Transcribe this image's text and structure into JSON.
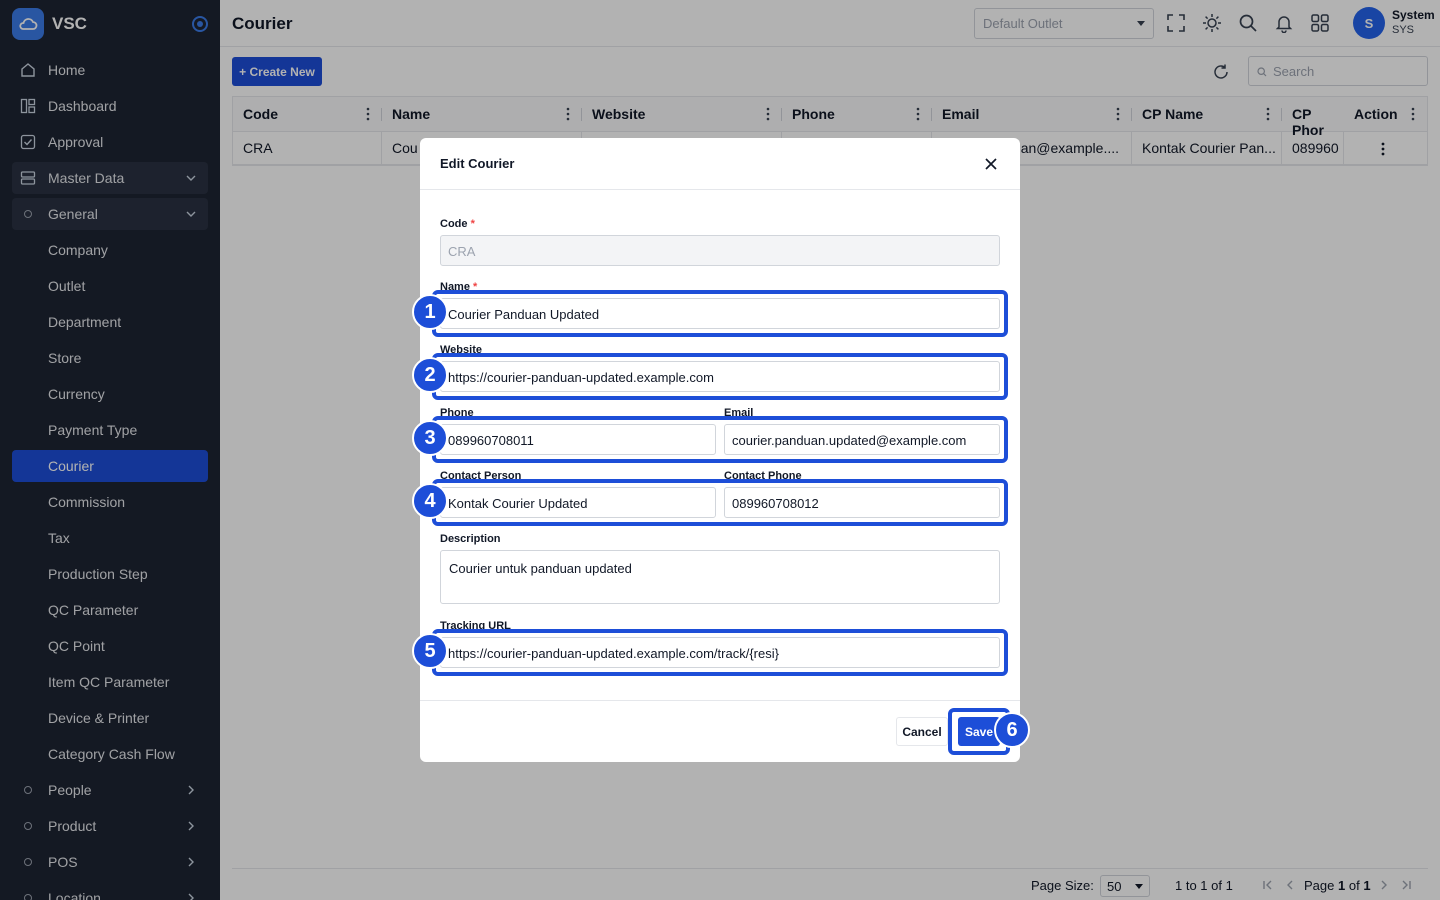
{
  "app": {
    "name": "VSC"
  },
  "sidebar": {
    "items": [
      {
        "label": "Home",
        "icon": "home-icon"
      },
      {
        "label": "Dashboard",
        "icon": "dashboard-icon"
      },
      {
        "label": "Approval",
        "icon": "approval-icon"
      },
      {
        "label": "Master Data",
        "icon": "database-icon"
      },
      {
        "label": "General",
        "icon": "circle-icon"
      }
    ],
    "sub_items": [
      "Company",
      "Outlet",
      "Department",
      "Store",
      "Currency",
      "Payment Type",
      "Courier",
      "Commission",
      "Tax",
      "Production Step",
      "QC Parameter",
      "QC Point",
      "Item QC Parameter",
      "Device & Printer",
      "Category Cash Flow"
    ],
    "groups": [
      "People",
      "Product",
      "POS",
      "Location"
    ]
  },
  "header": {
    "title": "Courier",
    "outlet_placeholder": "Default Outlet",
    "user_name": "System",
    "user_code": "SYS",
    "avatar_letter": "S"
  },
  "toolbar": {
    "create_label": "+ Create New",
    "search_placeholder": "Search"
  },
  "grid": {
    "columns": [
      "Code",
      "Name",
      "Website",
      "Phone",
      "Email",
      "CP Name",
      "CP Phor",
      "Action"
    ],
    "row": [
      "CRA",
      "Cou",
      "",
      "",
      "uan@example....",
      "Kontak Courier Pan...",
      "089960",
      ""
    ]
  },
  "footer": {
    "page_size_label": "Page Size:",
    "page_size": "50",
    "range": "1 to 1 of 1",
    "page_label": "Page",
    "page_current": "1",
    "page_of": "of",
    "page_total": "1"
  },
  "modal": {
    "title": "Edit Courier",
    "code_label": "Code",
    "code_value": "CRA",
    "name_label": "Name",
    "name_value": "Courier Panduan Updated",
    "website_label": "Website",
    "website_value": "https://courier-panduan-updated.example.com",
    "phone_label": "Phone",
    "phone_value": "089960708011",
    "email_label": "Email",
    "email_value": "courier.panduan.updated@example.com",
    "contact_person_label": "Contact Person",
    "contact_person_value": "Kontak Courier Updated",
    "contact_phone_label": "Contact Phone",
    "contact_phone_value": "089960708012",
    "description_label": "Description",
    "description_value": "Courier untuk panduan updated",
    "tracking_label": "Tracking URL",
    "tracking_value": "https://courier-panduan-updated.example.com/track/{resi}",
    "required_mark": "*",
    "cancel_label": "Cancel",
    "save_label": "Save"
  },
  "annotations": [
    "1",
    "2",
    "3",
    "4",
    "5",
    "6"
  ],
  "colors": {
    "sidebar_bg": "#1e2533",
    "accent": "#1d4ed8",
    "highlight": "#1d4ed8"
  }
}
